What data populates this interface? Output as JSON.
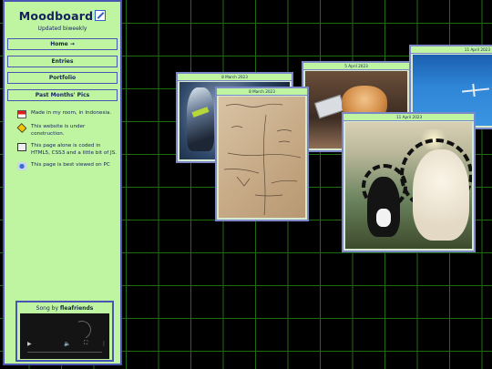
{
  "sidebar": {
    "logo_title": "Moodboard",
    "subtitle": "Updated biweekly",
    "nav": [
      {
        "label": "Home →"
      },
      {
        "label": "Entries"
      },
      {
        "label": "Portfolio"
      },
      {
        "label": "Past Months' Pics"
      }
    ],
    "notes": [
      {
        "icon": "indonesia-flag-icon",
        "text": "Made in my room, in Indonesia."
      },
      {
        "icon": "warning-sign-icon",
        "text": "This website is under construction."
      },
      {
        "icon": "code-page-icon",
        "text": "This page alone is coded in HTML5, CSS3 and a little bit of JS."
      },
      {
        "icon": "pc-globe-icon",
        "text": "This page is best viewed on PC"
      }
    ],
    "song": {
      "prefix": "Song by ",
      "artist": "fleafriends"
    }
  },
  "player": {
    "play_glyph": "▶",
    "volume_glyph": "🔈",
    "fullscreen_glyph": "⛶",
    "more_glyph": "⋮"
  },
  "cards": [
    {
      "date": "8 March 2023",
      "image": "robot-figure-photo"
    },
    {
      "date": "8 March 2023",
      "image": "handwritten-map-paper"
    },
    {
      "date": "5 April 2023",
      "image": "orange-cat-laptop-photo"
    },
    {
      "date": "11 April 2023",
      "image": "white-and-black-cats-collage"
    },
    {
      "date": "11 April 2023",
      "image": "plane-blue-sky-photo"
    }
  ],
  "colors": {
    "sidebar_bg": "#bff5a1",
    "sidebar_border": "#4a55b3",
    "text": "#15215c",
    "grid": "#1f6b12",
    "active_nav": "#3d4f7a"
  }
}
